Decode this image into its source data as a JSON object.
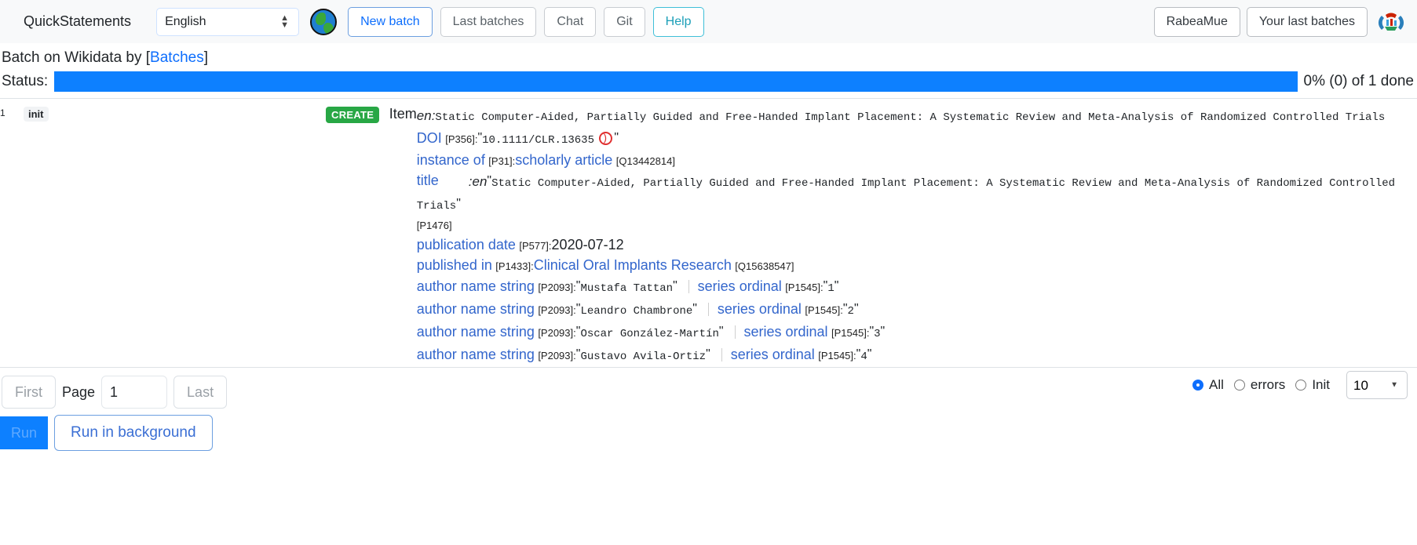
{
  "navbar": {
    "brand": "QuickStatements",
    "language_select": {
      "value": "English",
      "options": [
        "English"
      ]
    },
    "globe_icon": "globe-icon",
    "buttons": [
      {
        "label": "New batch",
        "style": "primary"
      },
      {
        "label": "Last batches",
        "style": "secondary"
      },
      {
        "label": "Chat",
        "style": "secondary"
      },
      {
        "label": "Git",
        "style": "secondary"
      },
      {
        "label": "Help",
        "style": "info"
      }
    ],
    "user_button": "RabeaMue",
    "your_last_batches_button": "Your last batches",
    "wikidata_logo": "wikidata-logo-icon"
  },
  "batch": {
    "title_prefix": "Batch on Wikidata by [",
    "title_link": "Batches",
    "title_suffix": "]",
    "status_label": "Status:",
    "status_text": "0% (0) of 1 done",
    "progress_percent": 100,
    "progress_color": "#0d80ff"
  },
  "command": {
    "row_number": "1",
    "status_badge": "init",
    "action_badge": "CREATE",
    "action_badge_color": "#28a745",
    "action_type": "Item",
    "label": {
      "lang": "en",
      "separator": ":",
      "value": "Static Computer-Aided, Partially Guided and Free-Handed Implant Placement: A Systematic Review and Meta-Analysis of Randomized Controlled Trials"
    },
    "statements": [
      {
        "prop_label": "DOI",
        "prop_id": "[P356]",
        "value_kind": "mono-quoted",
        "value": "10.1111/CLR.13635",
        "icon": "doi-external-link-icon"
      },
      {
        "prop_label": "instance of",
        "prop_id": "[P31]",
        "value_kind": "item",
        "value": "scholarly article",
        "value_id": "[Q13442814]"
      },
      {
        "prop_label": "title",
        "prop_id": "[P1476]",
        "value_kind": "monolingual",
        "lang": ":en",
        "value": "Static Computer-Aided, Partially Guided and Free-Handed Implant Placement: A Systematic Review and Meta-Analysis of Randomized Controlled Trials"
      },
      {
        "prop_label": "publication date",
        "prop_id": "[P577]",
        "value_kind": "plain",
        "value": "2020-07-12"
      },
      {
        "prop_label": "published in",
        "prop_id": "[P1433]",
        "value_kind": "item",
        "value": "Clinical Oral Implants Research",
        "value_id": "[Q15638547]"
      },
      {
        "prop_label": "author name string",
        "prop_id": "[P2093]",
        "value_kind": "mono-quoted",
        "value": "Mustafa Tattan",
        "qualifier": {
          "prop_label": "series ordinal",
          "prop_id": "[P1545]",
          "value": "1"
        }
      },
      {
        "prop_label": "author name string",
        "prop_id": "[P2093]",
        "value_kind": "mono-quoted",
        "value": "Leandro Chambrone",
        "qualifier": {
          "prop_label": "series ordinal",
          "prop_id": "[P1545]",
          "value": "2"
        }
      },
      {
        "prop_label": "author name string",
        "prop_id": "[P2093]",
        "value_kind": "mono-quoted",
        "value": "Oscar González-Martín",
        "qualifier": {
          "prop_label": "series ordinal",
          "prop_id": "[P1545]",
          "value": "3"
        }
      },
      {
        "prop_label": "author name string",
        "prop_id": "[P2093]",
        "value_kind": "mono-quoted",
        "value": "Gustavo Avila-Ortiz",
        "qualifier": {
          "prop_label": "series ordinal",
          "prop_id": "[P1545]",
          "value": "4"
        }
      }
    ]
  },
  "footer": {
    "first_button": "First",
    "page_label": "Page",
    "page_value": "1",
    "last_button": "Last",
    "run_button": "Run",
    "run_background_button": "Run in background",
    "filters": [
      {
        "label": "All",
        "checked": true
      },
      {
        "label": "errors",
        "checked": false
      },
      {
        "label": "Init",
        "checked": false
      }
    ],
    "rows_select": {
      "value": "10",
      "options": [
        "10"
      ]
    }
  }
}
